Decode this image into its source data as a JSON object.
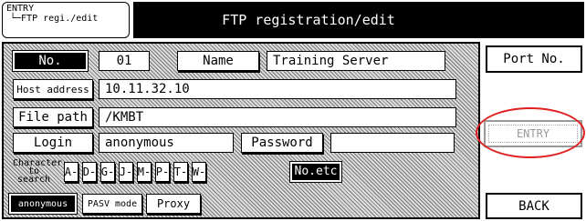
{
  "breadcrumb": {
    "line1": "ENTRY",
    "line2": "└─FTP regi./edit"
  },
  "header": {
    "title": "FTP registration/edit"
  },
  "form": {
    "no_label": "No.",
    "no_value": "01",
    "name_label": "Name",
    "name_value": "Training Server",
    "host_label": "Host address",
    "host_value": "10.11.32.10",
    "path_label": "File path",
    "path_value": "/KMBT",
    "login_label": "Login",
    "login_value": "anonymous",
    "password_label": "Password",
    "password_value": ""
  },
  "search": {
    "label_line1": "Character",
    "label_line2": "to search",
    "keys": [
      "A-",
      "D-",
      "G-",
      "J-",
      "M-",
      "P-",
      "T-",
      "W-"
    ],
    "etc_label": "No.etc"
  },
  "options": {
    "anonymous_label": "anonymous",
    "pasv_label": "PASV mode",
    "proxy_label": "Proxy"
  },
  "side": {
    "port_label": "Port No.",
    "entry_label": "ENTRY",
    "back_label": "BACK"
  },
  "colors": {
    "highlight": "#e02020"
  }
}
